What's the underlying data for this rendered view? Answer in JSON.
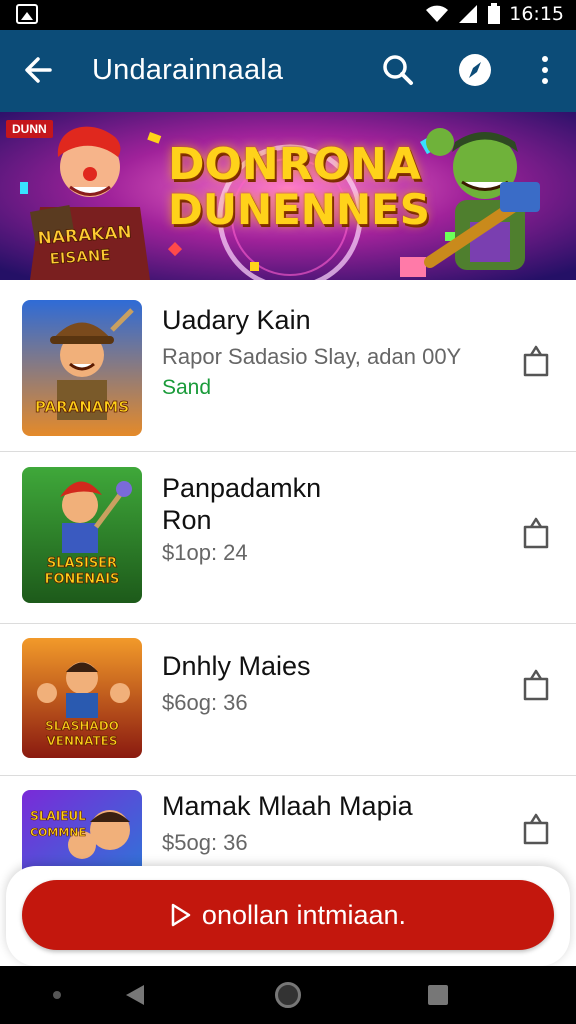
{
  "status_bar": {
    "time": "16:15"
  },
  "app_bar": {
    "title": "Undarainnaala"
  },
  "banner": {
    "tag": "DUNN",
    "title_line1": "DONRONA",
    "title_line2": "DUNENNES",
    "left_sign": "NARAKAN\nEISANE",
    "colors": {
      "bg1": "#3a1a86",
      "bg2": "#c2187a",
      "accent": "#ffd21a"
    }
  },
  "items": [
    {
      "name": "Uadary Kain",
      "subtitle": "Rapor Sadasio Slay, adan 00Y",
      "status": "Sand",
      "thumb_text": "PARANAMS",
      "icon": "shopping-bag-icon"
    },
    {
      "name": "Panpadamkn\nRon",
      "subtitle": "$1op: 24",
      "thumb_text": "SLASISER\nFONENAIS",
      "icon": "shopping-bag-icon"
    },
    {
      "name": "Dnhly Maies",
      "subtitle": "$6og: 36",
      "thumb_text": "SLASHADO\nVENNATES",
      "icon": "shopping-bag-icon"
    },
    {
      "name": "Mamak Mlaah Mapia",
      "subtitle": "$5og: 36",
      "thumb_text": "SLAIEUL\nCOMMNE",
      "icon": "shopping-bag-icon"
    }
  ],
  "cta": {
    "label": "onollan intmiaan."
  },
  "colors": {
    "app_bar": "#0c4c78",
    "cta": "#c3170d",
    "green_status": "#1a9b3a"
  }
}
